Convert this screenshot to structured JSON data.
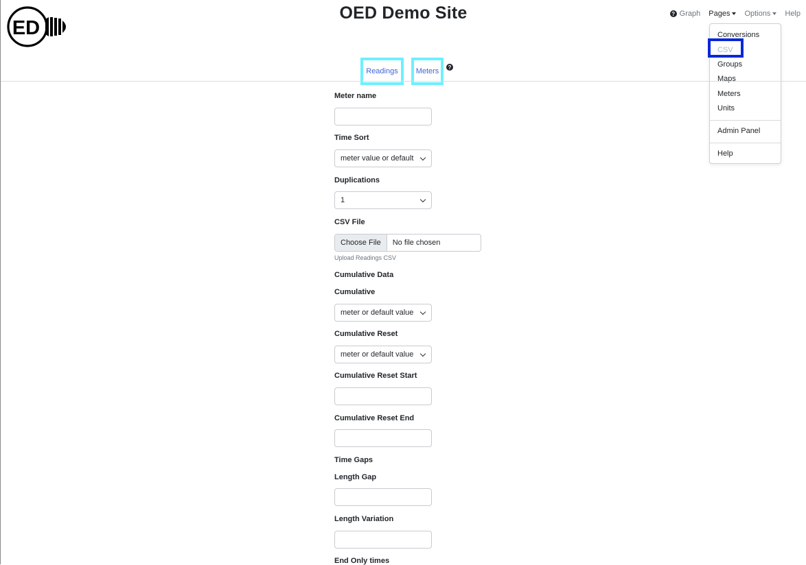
{
  "header": {
    "site_title": "OED Demo Site",
    "logo_text": "ED"
  },
  "topnav": {
    "graph": "Graph",
    "pages": "Pages",
    "options": "Options",
    "help": "Help"
  },
  "pages_menu": {
    "items": [
      "Conversions",
      "CSV",
      "Groups",
      "Maps",
      "Meters",
      "Units"
    ],
    "admin": "Admin Panel",
    "help": "Help",
    "disabled_item": "CSV"
  },
  "subnav": {
    "readings": "Readings",
    "meters": "Meters"
  },
  "form": {
    "meter_name": "Meter name",
    "time_sort": "Time Sort",
    "time_sort_value": "meter value or default",
    "duplications": "Duplications",
    "duplications_value": "1",
    "csv_file": "CSV File",
    "choose_file": "Choose File",
    "no_file": "No file chosen",
    "upload_help": "Upload Readings CSV",
    "cumulative_data": "Cumulative Data",
    "cumulative": "Cumulative",
    "cumulative_value": "meter or default value",
    "cumulative_reset": "Cumulative Reset",
    "cumulative_reset_value": "meter or default value",
    "cumulative_reset_start": "Cumulative Reset Start",
    "cumulative_reset_end": "Cumulative Reset End",
    "time_gaps": "Time Gaps",
    "length_gap": "Length Gap",
    "length_variation": "Length Variation",
    "end_only_times": "End Only times"
  },
  "colors": {
    "link": "#3f65d9",
    "subnav_highlight": "#6ef0ff",
    "csv_highlight": "#0a27d8"
  }
}
